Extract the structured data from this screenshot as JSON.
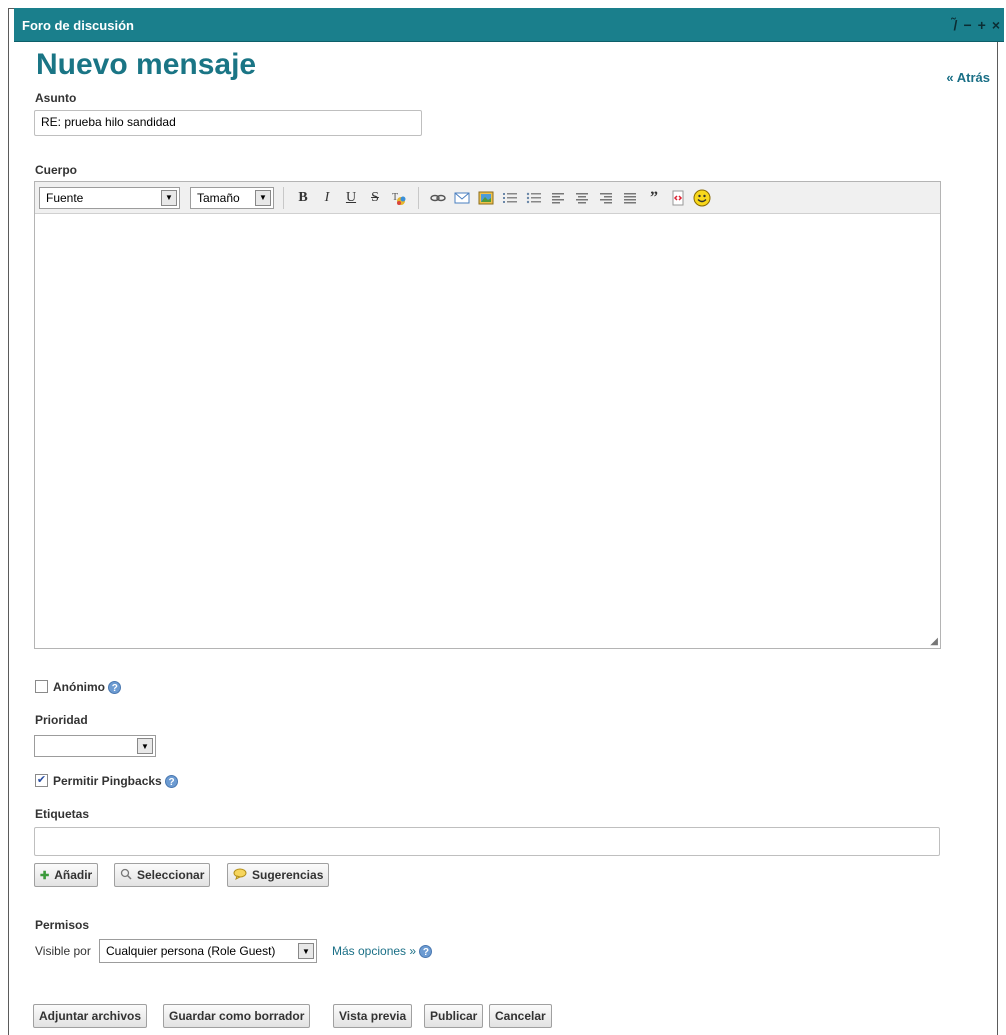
{
  "portlet": {
    "title": "Foro de discusión",
    "controls": [
      "/̃",
      "−",
      "+",
      "×"
    ]
  },
  "page_title": "Nuevo mensaje",
  "back_link": "« Atrás",
  "subject": {
    "label": "Asunto",
    "value": "RE: prueba hilo sandidad"
  },
  "body": {
    "label": "Cuerpo",
    "font_combo": "Fuente",
    "size_combo": "Tamaño",
    "format_buttons": [
      "B",
      "I",
      "U",
      "S"
    ],
    "icons": [
      "text-color-icon",
      "link-icon",
      "email-icon",
      "image-icon",
      "ordered-list-icon",
      "unordered-list-icon",
      "align-left-icon",
      "align-center-icon",
      "align-right-icon",
      "justify-icon",
      "quote-icon",
      "code-icon",
      "smiley-icon"
    ]
  },
  "anonymous": {
    "label": "Anónimo",
    "checked": false
  },
  "priority": {
    "label": "Prioridad",
    "value": ""
  },
  "pingbacks": {
    "label": "Permitir Pingbacks",
    "checked": true
  },
  "tags": {
    "label": "Etiquetas",
    "value": "",
    "add_button": "Añadir",
    "select_button": "Seleccionar",
    "suggestions_button": "Sugerencias"
  },
  "permissions": {
    "label": "Permisos",
    "visible_by_label": "Visible por",
    "visible_by_value": "Cualquier persona (Role Guest)",
    "more_options": "Más opciones »"
  },
  "actions": {
    "attach": "Adjuntar archivos",
    "save_draft": "Guardar como borrador",
    "preview": "Vista previa",
    "publish": "Publicar",
    "cancel": "Cancelar"
  },
  "colors": {
    "titlebar": "#1a7f8c",
    "heading": "#1a7585",
    "link": "#1a6f86"
  }
}
